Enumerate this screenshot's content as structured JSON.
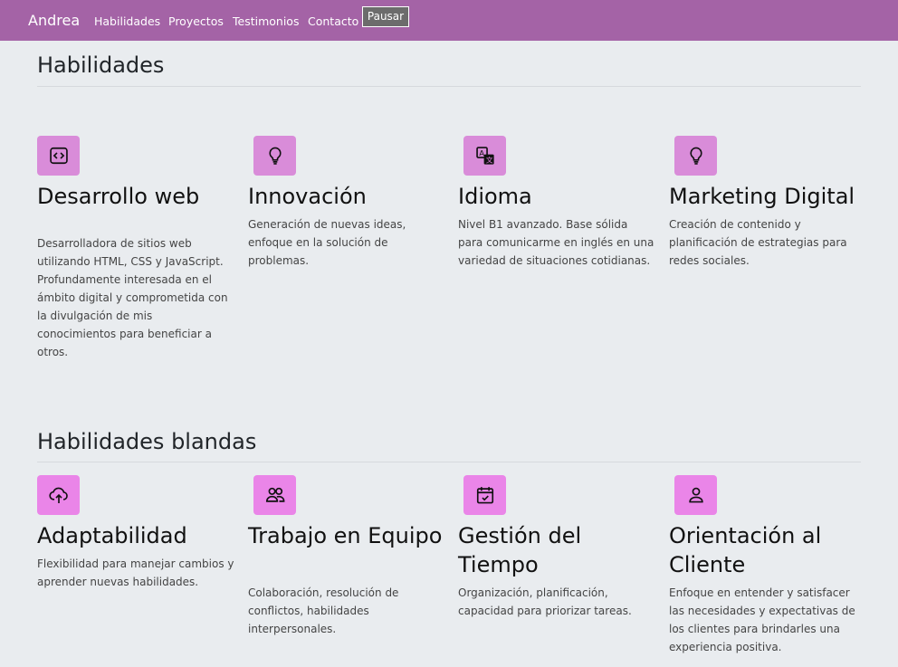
{
  "nav": {
    "brand": "Andrea",
    "links": [
      "Habilidades",
      "Proyectos",
      "Testimonios",
      "Contacto"
    ],
    "pause_label": "Pausar"
  },
  "skills": {
    "title": "Habilidades",
    "items": [
      {
        "icon": "code-icon",
        "title": "Desarrollo web",
        "text": "Desarrolladora de sitios web utilizando HTML, CSS y JavaScript. Profundamente interesada en el ámbito digital y comprometida con la divulgación de mis conocimientos para beneficiar a otros."
      },
      {
        "icon": "lightbulb-icon",
        "title": "Innovación",
        "text": "Generación de nuevas ideas, enfoque en la solución de problemas."
      },
      {
        "icon": "translate-icon",
        "title": "Idioma",
        "text": "Nivel B1 avanzado. Base sólida para comunicarme en inglés en una variedad de situaciones cotidianas."
      },
      {
        "icon": "lightbulb-icon",
        "title": "Marketing Digital",
        "text": "Creación de contenido y planificación de estrategias para redes sociales."
      }
    ]
  },
  "soft_skills": {
    "title": "Habilidades blandas",
    "items": [
      {
        "icon": "cloud-upload-icon",
        "title": "Adaptabilidad",
        "text": "Flexibilidad para manejar cambios y aprender nuevas habilidades."
      },
      {
        "icon": "people-icon",
        "title": "Trabajo en Equipo",
        "text": "Colaboración, resolución de conflictos, habilidades interpersonales."
      },
      {
        "icon": "calendar-check-icon",
        "title": "Gestión del Tiempo",
        "text": "Organización, planificación, capacidad para priorizar tareas."
      },
      {
        "icon": "person-icon",
        "title": "Orientación al Cliente",
        "text": "Enfoque en entender y satisfacer las necesidades y expectativas de los clientes para brindarles una experiencia positiva."
      }
    ]
  },
  "colors": {
    "navbar": "#a463a6",
    "icon_bg": "#d98cd9",
    "icon_bg_soft": "#ea85e8",
    "page_bg": "#e9ecef"
  }
}
